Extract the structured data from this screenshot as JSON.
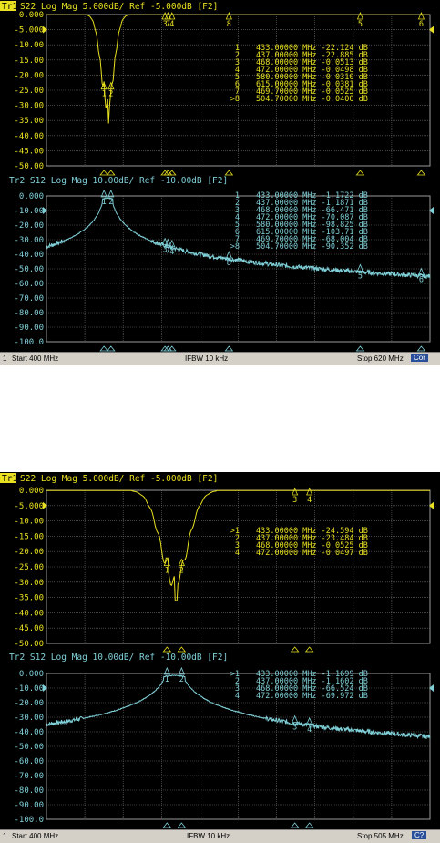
{
  "screens": [
    {
      "trace1": {
        "badge": "Tr1",
        "header": "S22 Log Mag 5.000dB/ Ref -5.000dB [F2]",
        "color": "#e8e020",
        "yticks": [
          "0.000",
          "-5.000",
          "-10.00",
          "-15.00",
          "-20.00",
          "-25.00",
          "-30.00",
          "-35.00",
          "-40.00",
          "-45.00",
          "-50.00"
        ],
        "markers": [
          {
            "label": "1",
            "text": "433.00000 MHz -22.124 dB"
          },
          {
            "label": "2",
            "text": "437.00000 MHz -22.885 dB"
          },
          {
            "label": "3",
            "text": "468.00000 MHz -0.0513 dB"
          },
          {
            "label": "4",
            "text": "472.00000 MHz -0.0498 dB"
          },
          {
            "label": "5",
            "text": "580.00000 MHz -0.0310 dB"
          },
          {
            "label": "6",
            "text": "615.00000 MHz -0.0381 dB"
          },
          {
            "label": "7",
            "text": "469.70000 MHz -0.0525 dB"
          },
          {
            "label": ">8",
            "text": "504.70000 MHz -0.0400 dB"
          }
        ]
      },
      "trace2": {
        "badge": "Tr2",
        "header": "Tr2 S12 Log Mag 10.00dB/ Ref -10.00dB [F2]",
        "color": "#7fd0d8",
        "yticks": [
          "0.000",
          "-10.00",
          "-20.00",
          "-30.00",
          "-40.00",
          "-50.00",
          "-60.00",
          "-70.00",
          "-80.00",
          "-90.00",
          "-100.0"
        ],
        "markers": [
          {
            "label": "1",
            "text": "433.00000 MHz -1.1722 dB"
          },
          {
            "label": "2",
            "text": "437.00000 MHz -1.1871 dB"
          },
          {
            "label": "3",
            "text": "468.00000 MHz -66.471 dB"
          },
          {
            "label": "4",
            "text": "472.00000 MHz -70.087 dB"
          },
          {
            "label": "5",
            "text": "580.00000 MHz -98.825 dB"
          },
          {
            "label": "6",
            "text": "615.00000 MHz -103.71 dB"
          },
          {
            "label": "7",
            "text": "469.70000 MHz -68.004 dB"
          },
          {
            "label": ">8",
            "text": "504.70000 MHz -90.352 dB"
          }
        ]
      },
      "status": {
        "channel": "1",
        "start": "Start 400 MHz",
        "ifbw": "IFBW 10 kHz",
        "stop": "Stop 620 MHz",
        "cor": "Cor"
      }
    },
    {
      "trace1": {
        "badge": "Tr1",
        "header": "S22 Log Mag 5.000dB/ Ref -5.000dB [F2]",
        "color": "#e8e020",
        "yticks": [
          "0.000",
          "-5.000",
          "-10.00",
          "-15.00",
          "-20.00",
          "-25.00",
          "-30.00",
          "-35.00",
          "-40.00",
          "-45.00",
          "-50.00"
        ],
        "markers": [
          {
            "label": ">1",
            "text": "433.00000 MHz -24.594 dB"
          },
          {
            "label": "2",
            "text": "437.00000 MHz -23.484 dB"
          },
          {
            "label": "3",
            "text": "468.00000 MHz -0.0525 dB"
          },
          {
            "label": "4",
            "text": "472.00000 MHz -0.0497 dB"
          }
        ]
      },
      "trace2": {
        "badge": "Tr2",
        "header": "Tr2 S12 Log Mag 10.00dB/ Ref -10.00dB [F2]",
        "color": "#7fd0d8",
        "yticks": [
          "0.000",
          "-10.00",
          "-20.00",
          "-30.00",
          "-40.00",
          "-50.00",
          "-60.00",
          "-70.00",
          "-80.00",
          "-90.00",
          "-100.0"
        ],
        "markers": [
          {
            "label": ">1",
            "text": "433.00000 MHz -1.1699 dB"
          },
          {
            "label": "2",
            "text": "437.00000 MHz -1.1602 dB"
          },
          {
            "label": "3",
            "text": "468.00000 MHz -66.524 dB"
          },
          {
            "label": "4",
            "text": "472.00000 MHz -69.972 dB"
          }
        ]
      },
      "status": {
        "channel": "1",
        "start": "Start 400 MHz",
        "ifbw": "IFBW 10 kHz",
        "stop": "Stop 505 MHz",
        "cor": "C?"
      }
    }
  ]
}
